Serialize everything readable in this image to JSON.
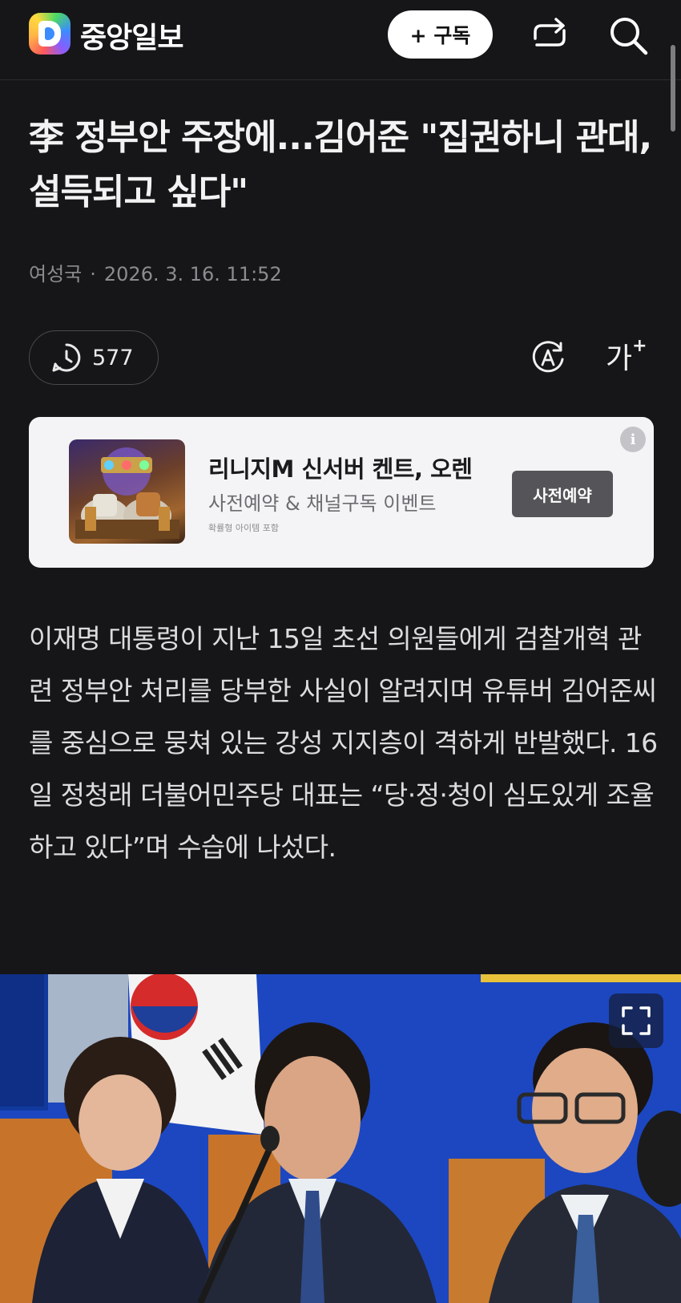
{
  "header": {
    "brand_name": "중앙일보",
    "subscribe_label": "+ 구독",
    "icons": [
      "daum-logo-icon",
      "share-icon",
      "search-icon"
    ]
  },
  "article": {
    "headline": "李 정부안 주장에...김어준 \"집권하니 관대, 설득되고 싶다\"",
    "author": "여성국",
    "separator": "·",
    "date": "2026. 3. 16. 11:52",
    "view_count": "577",
    "font_size_label": "가",
    "font_size_plus": "+",
    "body": "이재명 대통령이 지난 15일 초선 의원들에게 검찰개혁 관련 정부안 처리를 당부한 사실이 알려지며 유튜버 김어준씨를 중심으로 뭉쳐 있는 강성 지지층이 격하게 반발했다. 16일 정청래 더불어민주당 대표는 “당·정·청이 심도있게 조율하고 있다”며 수습에 나섰다."
  },
  "ad": {
    "title": "리니지M 신서버 켄트, 오렌",
    "subtitle": "사전예약 & 채널구독 이벤트",
    "note": "확률형 아이템 포함",
    "button_label": "사전예약",
    "info_label": "i"
  },
  "colors": {
    "background": "#161618",
    "ad_background": "#f4f4f6",
    "ad_button": "#555559",
    "photo_backdrop": "#1d46b8"
  }
}
